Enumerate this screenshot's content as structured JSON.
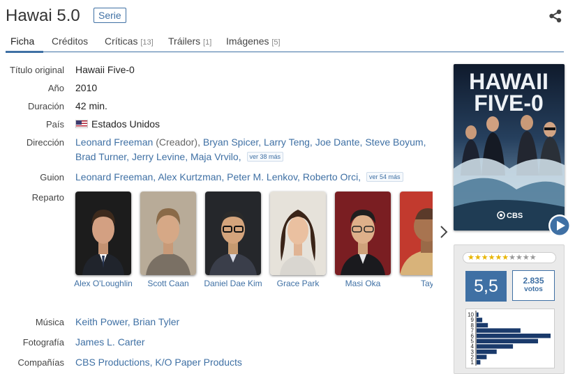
{
  "header": {
    "title": "Hawai 5.0",
    "badge": "Serie"
  },
  "tabs": [
    {
      "label": "Ficha",
      "count": ""
    },
    {
      "label": "Créditos",
      "count": ""
    },
    {
      "label": "Críticas",
      "count": "[13]"
    },
    {
      "label": "Tráilers",
      "count": "[1]"
    },
    {
      "label": "Imágenes",
      "count": "[5]"
    }
  ],
  "details": {
    "original_title": {
      "label": "Título original",
      "value": "Hawaii Five-0"
    },
    "year": {
      "label": "Año",
      "value": "2010"
    },
    "duration": {
      "label": "Duración",
      "value": "42 min."
    },
    "country": {
      "label": "País",
      "value": "Estados Unidos"
    },
    "direction": {
      "label": "Dirección",
      "line1": [
        "Leonard Freeman",
        "(Creador),",
        "Bryan Spicer,",
        "Larry Teng,",
        "Joe Dante,",
        "Steve Boyum,"
      ],
      "line2": [
        "Brad Turner,",
        "Jerry Levine,",
        "Maja Vrvilo,"
      ],
      "more": "ver 38 más"
    },
    "script": {
      "label": "Guion",
      "names": [
        "Leonard Freeman,",
        "Alex Kurtzman,",
        "Peter M. Lenkov,",
        "Roberto Orci,"
      ],
      "more": "ver 54 más"
    },
    "cast": {
      "label": "Reparto",
      "members": [
        "Alex O'Loughlin",
        "Scott Caan",
        "Daniel Dae Kim",
        "Grace Park",
        "Masi Oka",
        "Taylor"
      ]
    },
    "music": {
      "label": "Música",
      "names": [
        "Keith Power,",
        "Brian Tyler"
      ]
    },
    "photography": {
      "label": "Fotografía",
      "value": "James L. Carter"
    },
    "companies": {
      "label": "Compañías",
      "names": [
        "CBS Productions,",
        "K/O Paper Products"
      ]
    }
  },
  "poster": {
    "title_line1": "HAWAII",
    "title_line2": "FIVE-0",
    "network": "CBS"
  },
  "rating": {
    "score": "5,5",
    "votes": "2.835",
    "votes_label": "votos",
    "stars_filled": 5.5,
    "stars_total": 10,
    "histogram": {
      "labels": [
        "10",
        "9",
        "8",
        "7",
        "6",
        "5",
        "4",
        "3",
        "2",
        "1"
      ],
      "values": [
        3,
        9,
        18,
        70,
        118,
        98,
        58,
        32,
        16,
        6
      ]
    }
  },
  "colors": {
    "accent": "#3f70a4",
    "link": "#3f70a4",
    "star": "#e8b500",
    "histogram_bar": "#1a3a6b"
  }
}
